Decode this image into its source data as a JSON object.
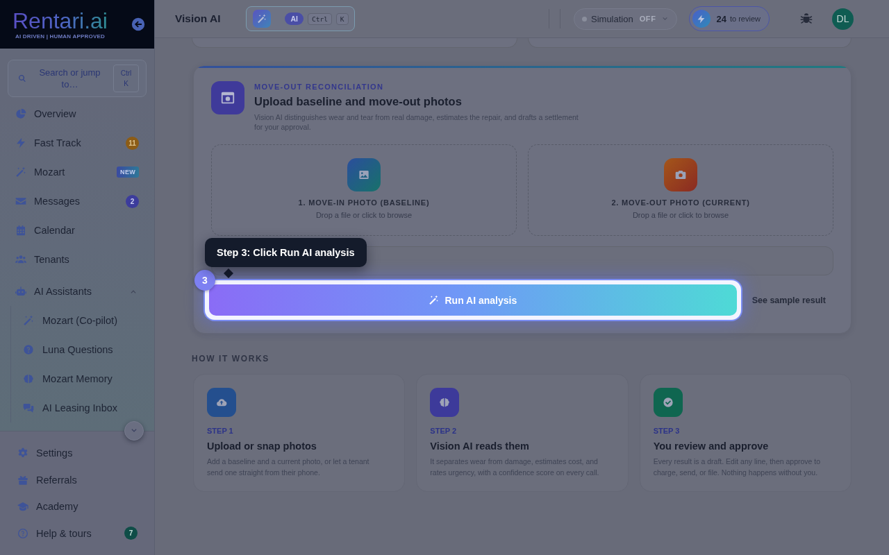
{
  "sidebar": {
    "logo": {
      "wordmark": "Rentari.ai",
      "tagline": "AI DRIVEN | HUMAN APPROVED"
    },
    "search": {
      "label": "Search or jump to…",
      "shortcut": "Ctrl K"
    },
    "nav": [
      {
        "label": "Overview"
      },
      {
        "label": "Fast Track",
        "badge": {
          "kind": "warning",
          "text": "11"
        }
      },
      {
        "label": "Mozart",
        "badge": {
          "kind": "new",
          "text": "NEW"
        }
      },
      {
        "label": "Messages",
        "badge": {
          "kind": "info",
          "text": "2"
        }
      },
      {
        "label": "Calendar"
      },
      {
        "label": "Tenants"
      }
    ],
    "group": {
      "label": "AI Assistants",
      "expanded": true,
      "children": [
        {
          "label": "Mozart (Co-pilot)"
        },
        {
          "label": "Luna Questions"
        },
        {
          "label": "Mozart Memory"
        },
        {
          "label": "AI Leasing Inbox"
        }
      ]
    },
    "footer_nav": [
      {
        "label": "Settings"
      },
      {
        "label": "Referrals"
      },
      {
        "label": "Academy"
      },
      {
        "label": "Help & tours",
        "badge": {
          "kind": "success",
          "text": "7"
        }
      }
    ]
  },
  "topbar": {
    "title": "Vision AI",
    "command": {
      "tag": "AI",
      "keys": [
        "Ctrl",
        "K"
      ]
    },
    "simulation": {
      "label": "Simulation",
      "state": "OFF",
      "on": false
    },
    "review": {
      "count": "24",
      "label": "to review"
    },
    "avatar": {
      "initials": "DL"
    }
  },
  "upload_card": {
    "eyebrow": "MOVE-OUT RECONCILIATION",
    "title": "Upload baseline and move-out photos",
    "description": "Vision AI distinguishes wear and tear from real damage, estimates the repair, and drafts a settlement for your approval.",
    "dropzones": [
      {
        "kind": "baseline",
        "label": "1. MOVE-IN PHOTO (BASELINE)",
        "hint": "Drop a file or click to browse"
      },
      {
        "kind": "current",
        "label": "2. MOVE-OUT PHOTO (CURRENT)",
        "hint": "Drop a file or click to browse"
      }
    ],
    "run_button": {
      "label": "Run AI analysis",
      "highlighted": true
    },
    "sample_link": "See sample result"
  },
  "tour": {
    "step": "3",
    "message": "Step 3: Click Run AI analysis"
  },
  "how_it_works": {
    "heading": "HOW IT WORKS",
    "steps": [
      {
        "kind": "upload",
        "step": "STEP 1",
        "title": "Upload or snap photos",
        "description": "Add a baseline and a current photo, or let a tenant send one straight from their phone."
      },
      {
        "kind": "read",
        "step": "STEP 2",
        "title": "Vision AI reads them",
        "description": "It separates wear from damage, estimates cost, and rates urgency, with a confidence score on every call."
      },
      {
        "kind": "approve",
        "step": "STEP 3",
        "title": "You review and approve",
        "description": "Every result is a draft. Edit any line, then approve to charge, send, or file. Nothing happens without you."
      }
    ]
  }
}
